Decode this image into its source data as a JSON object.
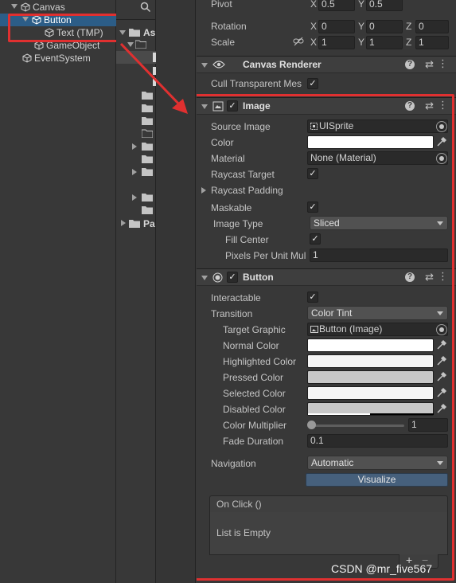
{
  "hierarchy": {
    "items": [
      {
        "label": "Canvas"
      },
      {
        "label": "Button"
      },
      {
        "label": "Text (TMP)"
      },
      {
        "label": "GameObject"
      },
      {
        "label": "EventSystem"
      }
    ]
  },
  "project": {
    "search_icon": "search-icon",
    "items": [
      "As",
      "Pa"
    ]
  },
  "rect_transform": {
    "pivot_label": "Pivot",
    "pivot_x": "0.5",
    "pivot_y": "0.5",
    "rotation_label": "Rotation",
    "rot_x": "0",
    "rot_y": "0",
    "rot_z": "0",
    "scale_label": "Scale",
    "scale_x": "1",
    "scale_y": "1",
    "scale_z": "1",
    "axis_x": "X",
    "axis_y": "Y",
    "axis_z": "Z"
  },
  "canvas_renderer": {
    "title": "Canvas Renderer",
    "cull_label": "Cull Transparent Mes"
  },
  "image": {
    "title": "Image",
    "source_image_label": "Source Image",
    "source_image_value": "UISprite",
    "color_label": "Color",
    "material_label": "Material",
    "material_value": "None (Material)",
    "raycast_target_label": "Raycast Target",
    "raycast_padding_label": "Raycast Padding",
    "maskable_label": "Maskable",
    "image_type_label": "Image Type",
    "image_type_value": "Sliced",
    "fill_center_label": "Fill Center",
    "ppu_label": "Pixels Per Unit Mul",
    "ppu_value": "1"
  },
  "button": {
    "title": "Button",
    "interactable_label": "Interactable",
    "transition_label": "Transition",
    "transition_value": "Color Tint",
    "target_graphic_label": "Target Graphic",
    "target_graphic_value": "Button (Image)",
    "normal_color_label": "Normal Color",
    "highlighted_color_label": "Highlighted Color",
    "pressed_color_label": "Pressed Color",
    "selected_color_label": "Selected Color",
    "disabled_color_label": "Disabled Color",
    "color_multiplier_label": "Color Multiplier",
    "color_multiplier_value": "1",
    "fade_duration_label": "Fade Duration",
    "fade_duration_value": "0.1",
    "navigation_label": "Navigation",
    "navigation_value": "Automatic",
    "visualize_label": "Visualize",
    "onclick_label": "On Click ()",
    "list_empty_label": "List is Empty",
    "add_label": "+",
    "remove_label": "−"
  },
  "colors": {
    "normal": "#ffffff",
    "highlighted": "#f5f5f5",
    "pressed": "#c8c8c8",
    "selected": "#f5f5f5",
    "disabled": "#c8c8c8",
    "highlight_red": "#e03030",
    "selection_blue": "#2c5d87"
  },
  "watermark": "CSDN @mr_five567"
}
